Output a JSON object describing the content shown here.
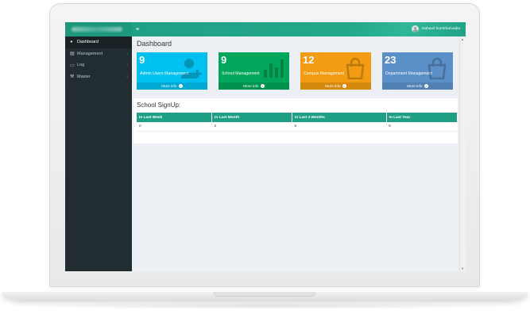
{
  "sidebar": {
    "items": [
      {
        "label": "Dashboard",
        "icon": "dashboard-icon",
        "active": true
      },
      {
        "label": "Management",
        "icon": "list-icon",
        "has_children": true
      },
      {
        "label": "Log",
        "icon": "file-icon",
        "has_children": true
      },
      {
        "label": "Master",
        "icon": "wrench-icon",
        "has_children": true
      }
    ]
  },
  "topbar": {
    "toggle_icon": "menu-icon",
    "user_name": "mahavir kumbharvadia"
  },
  "page": {
    "title": "Dashboard"
  },
  "boxes": [
    {
      "count": "9",
      "label": "Admin Users Management",
      "more": "More info",
      "color": "#00c0ef",
      "icon": "user-plus-icon"
    },
    {
      "count": "9",
      "label": "School Management",
      "more": "More info",
      "color": "#00a65a",
      "icon": "bar-chart-icon"
    },
    {
      "count": "12",
      "label": "Campus Management",
      "more": "More info",
      "color": "#f39c12",
      "icon": "shopping-bag-icon"
    },
    {
      "count": "23",
      "label": "Department Management",
      "more": "More info",
      "color": "#5b8fc7",
      "icon": "shopping-bag-icon"
    }
  ],
  "signup": {
    "title": "School SignUp:",
    "headers": [
      "In Last Week",
      "In Last Month",
      "In Last 3 Months",
      "In Last Year"
    ],
    "values": [
      "0",
      "2",
      "6",
      "9"
    ]
  },
  "colors": {
    "accent": "#1fa085",
    "sidebar_bg": "#222d32"
  }
}
